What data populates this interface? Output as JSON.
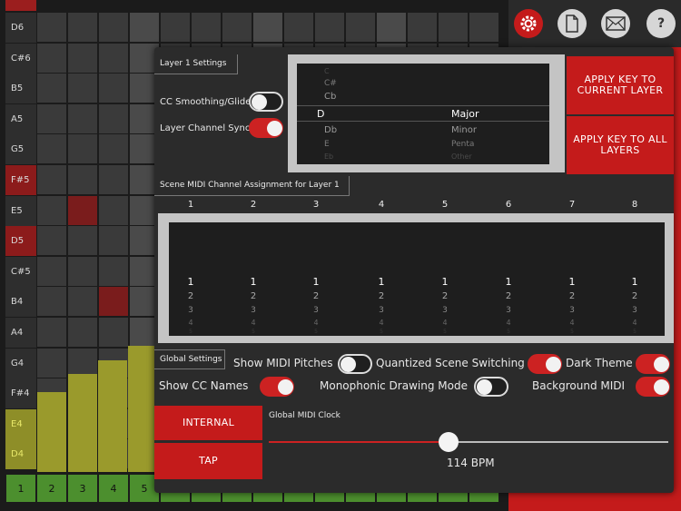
{
  "toolbar": {
    "icons": [
      "gear-icon",
      "document-icon",
      "mail-icon",
      "help-icon"
    ],
    "help_glyph": "?"
  },
  "grid": {
    "notes": [
      "D6",
      "C#6",
      "B5",
      "A5",
      "G5",
      "F#5",
      "E5",
      "D5",
      "C#5",
      "B4",
      "A4",
      "G4",
      "F#4",
      "E4",
      "D4"
    ],
    "columns": [
      "1",
      "2",
      "3",
      "4",
      "5"
    ]
  },
  "panel": {
    "layer_settings_tag": "Layer 1 Settings",
    "cc_smoothing_label": "CC Smoothing/Glide",
    "cc_smoothing_on": false,
    "layer_channel_sync_label": "Layer Channel Sync",
    "layer_channel_sync_on": true,
    "key_picker": {
      "keys": [
        "C",
        "C#",
        "Cb",
        "D",
        "Db",
        "E",
        "Eb"
      ],
      "scales": [
        "Major",
        "Minor",
        "Penta",
        "Other"
      ],
      "selected_key": "D",
      "selected_scale": "Major"
    },
    "apply_current": "APPLY KEY TO CURRENT LAYER",
    "apply_all": "APPLY KEY TO ALL LAYERS",
    "scene_tag": "Scene MIDI Channel Assignment for Layer 1",
    "scene_headers": [
      "1",
      "2",
      "3",
      "4",
      "5",
      "6",
      "7",
      "8"
    ],
    "channel_values": [
      "1",
      "2",
      "3",
      "4",
      "5"
    ],
    "global_tag": "Global Settings",
    "show_midi_pitches": "Show MIDI Pitches",
    "show_midi_pitches_on": false,
    "quantized_scene": "Quantized Scene Switching",
    "quantized_scene_on": true,
    "dark_theme": "Dark Theme",
    "dark_theme_on": true,
    "show_cc_names": "Show CC Names",
    "show_cc_names_on": true,
    "mono_mode": "Monophonic Drawing Mode",
    "mono_mode_on": false,
    "background_midi": "Background MIDI",
    "background_midi_on": true,
    "internal_btn": "INTERNAL",
    "tap_btn": "TAP",
    "clock_label": "Global MIDI Clock",
    "bpm": "114 BPM",
    "clock_level_fraction": 0.45
  },
  "colors": {
    "accent": "#c41b1b",
    "bar": "#9a9a2c",
    "step": "#4c8f2e"
  }
}
